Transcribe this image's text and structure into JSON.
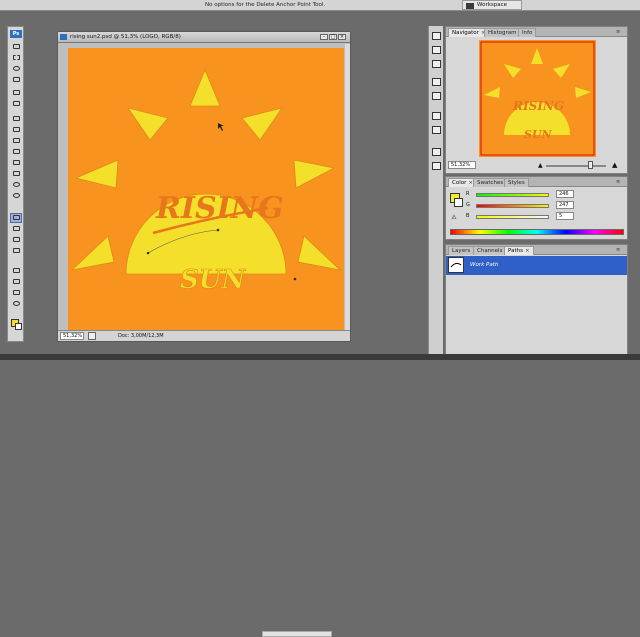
{
  "options_bar": {
    "message": "No options for the Delete Anchor Point Tool.",
    "workspace_label": "Workspace"
  },
  "toolbox": {
    "logo": "Ps",
    "tools": [
      "move-tool",
      "marquee-tool",
      "lasso-tool",
      "magic-wand-tool",
      "crop-tool",
      "slice-tool",
      "healing-brush-tool",
      "brush-tool",
      "clone-stamp-tool",
      "history-brush-tool",
      "eraser-tool",
      "gradient-tool",
      "blur-tool",
      "dodge-tool",
      "pen-tool",
      "type-tool",
      "path-selection-tool",
      "shape-tool",
      "notes-tool",
      "eyedropper-tool",
      "hand-tool",
      "zoom-tool"
    ],
    "active_tool": "pen-tool",
    "foreground_color": "#f4e02a",
    "background_color": "#ffffff"
  },
  "document": {
    "title": "rising sun2.psd @ 51,3% (LOGO, RGB/8)",
    "zoom": "51,32%",
    "doc_info": "Doc: 3,00M/12,3M",
    "canvas_color": "#f7931e",
    "artwork": {
      "headline": "RISING",
      "subline": "SUN",
      "sun_color": "#f4e02a",
      "text_color": "#e8761a"
    }
  },
  "navigator": {
    "tabs": [
      "Navigator",
      "Histogram",
      "Info"
    ],
    "active_tab": "Navigator",
    "zoom": "51,32%",
    "thumb_headline": "RISING",
    "thumb_subline": "SUN"
  },
  "color": {
    "tabs": [
      "Color",
      "Swatches",
      "Styles"
    ],
    "active_tab": "Color",
    "channels": [
      {
        "label": "R",
        "value": "246"
      },
      {
        "label": "G",
        "value": "247"
      },
      {
        "label": "B",
        "value": "5"
      }
    ],
    "warning_icon": "gamut-warning-icon"
  },
  "paths": {
    "tabs": [
      "Layers",
      "Channels",
      "Paths"
    ],
    "active_tab": "Paths",
    "items": [
      {
        "name": "Work Path"
      }
    ]
  }
}
